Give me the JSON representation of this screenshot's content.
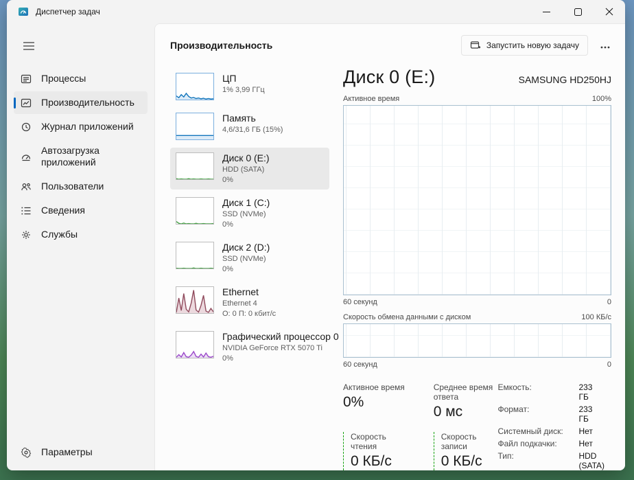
{
  "window": {
    "title": "Диспетчер задач"
  },
  "sidebar": {
    "items": [
      {
        "label": "Процессы"
      },
      {
        "label": "Производительность",
        "selected": true
      },
      {
        "label": "Журнал приложений"
      },
      {
        "label": "Автозагрузка приложений"
      },
      {
        "label": "Пользователи"
      },
      {
        "label": "Сведения"
      },
      {
        "label": "Службы"
      }
    ],
    "settings_label": "Параметры"
  },
  "header": {
    "title": "Производительность",
    "run_task_label": "Запустить новую задачу"
  },
  "perf_list": [
    {
      "name": "ЦП",
      "line1": "1% 3,99 ГГц",
      "spark": {
        "color": "#1175bb",
        "fill": "#dcebf8",
        "border": "#7aaede",
        "values": [
          14,
          7,
          19,
          10,
          24,
          12,
          6,
          8,
          4,
          6,
          3,
          5,
          2,
          4,
          2,
          3
        ]
      }
    },
    {
      "name": "Память",
      "line1": "4,6/31,6 ГБ (15%)",
      "spark": {
        "color": "#1175bb",
        "fill": "#dcebf8",
        "border": "#7aaede",
        "values": [
          15,
          15,
          15,
          15,
          15,
          15,
          15,
          15,
          15,
          15,
          15,
          15,
          15,
          15,
          15,
          15
        ]
      }
    },
    {
      "name": "Диск 0 (E:)",
      "line1": "HDD (SATA)",
      "line2": "0%",
      "selected": true,
      "spark": {
        "color": "#46a046",
        "fill": "",
        "border": "#bdbdbd",
        "values": [
          2,
          0,
          1,
          0,
          0,
          2,
          0,
          1,
          0,
          0,
          1,
          0,
          0,
          1,
          0,
          0
        ]
      }
    },
    {
      "name": "Диск 1 (C:)",
      "line1": "SSD (NVMe)",
      "line2": "0%",
      "spark": {
        "color": "#46a046",
        "fill": "",
        "border": "#bdbdbd",
        "values": [
          9,
          2,
          0,
          3,
          0,
          1,
          0,
          0,
          2,
          0,
          0,
          1,
          0,
          0,
          0,
          1
        ]
      }
    },
    {
      "name": "Диск 2 (D:)",
      "line1": "SSD (NVMe)",
      "line2": "0%",
      "spark": {
        "color": "#46a046",
        "fill": "",
        "border": "#bdbdbd",
        "values": [
          1,
          0,
          0,
          1,
          0,
          0,
          0,
          2,
          0,
          0,
          1,
          0,
          0,
          0,
          1,
          0
        ]
      }
    },
    {
      "name": "Ethernet",
      "line1": "Ethernet 4",
      "line2": "О: 0 П: 0 кбит/с",
      "spark": {
        "color": "#8f4a5c",
        "fill": "#ecd9de",
        "border": "#bdbdbd",
        "values": [
          3,
          58,
          10,
          75,
          15,
          5,
          38,
          88,
          12,
          4,
          30,
          68,
          8,
          3,
          18,
          5
        ]
      }
    },
    {
      "name": "Графический процессор 0",
      "line1": "NVIDIA GeForce RTX 5070 Ti",
      "line2": "0%",
      "spark": {
        "color": "#9a48c9",
        "fill": "#ecdcf6",
        "border": "#bdbdbd",
        "values": [
          2,
          12,
          3,
          20,
          4,
          2,
          10,
          24,
          5,
          2,
          14,
          3,
          18,
          4,
          2,
          6
        ]
      }
    }
  ],
  "detail": {
    "title": "Диск 0 (E:)",
    "device": "SAMSUNG HD250HJ",
    "chart_active": {
      "label": "Активное время",
      "max": "100%",
      "x_left": "60 секунд",
      "x_right": "0"
    },
    "chart_transfer": {
      "label": "Скорость обмена данными с диском",
      "max": "100 КБ/с",
      "x_left": "60 секунд",
      "x_right": "0"
    },
    "stats": [
      {
        "label": "Активное время",
        "value": "0%"
      },
      {
        "label": "Среднее время ответа",
        "value": "0 мс"
      },
      {
        "label": "Скорость чтения",
        "value": "0 КБ/с"
      },
      {
        "label": "Скорость записи",
        "value": "0 КБ/с"
      }
    ],
    "props": [
      {
        "label": "Емкость:",
        "value": "233 ГБ"
      },
      {
        "label": "Формат:",
        "value": "233 ГБ"
      },
      {
        "label": "Системный диск:",
        "value": "Нет"
      },
      {
        "label": "Файл подкачки:",
        "value": "Нет"
      },
      {
        "label": "Тип:",
        "value": "HDD (SATA)"
      }
    ]
  },
  "colors": {
    "accent": "#0067c0",
    "disk_green": "#13a10e",
    "cpu_blue": "#1175bb"
  }
}
